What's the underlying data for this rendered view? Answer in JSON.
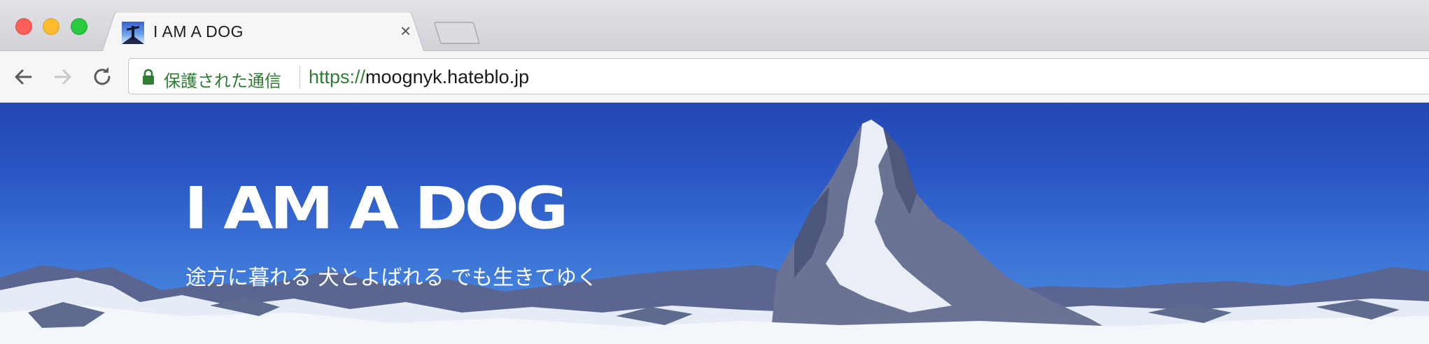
{
  "window": {
    "controls": [
      "close",
      "minimize",
      "maximize"
    ]
  },
  "tab": {
    "title": "I AM A DOG",
    "close_label": "×"
  },
  "toolbar": {
    "back_icon": "arrow-left-icon",
    "forward_icon": "arrow-right-icon",
    "reload_icon": "reload-icon"
  },
  "omnibox": {
    "security_label": "保護された通信",
    "url_scheme": "https://",
    "url_host": "moognyk.hateblo.jp",
    "colors": {
      "secure": "#2e7d32"
    }
  },
  "page": {
    "site_title": "I AM A DOG",
    "site_subtitle": "途方に暮れる 犬とよばれる でも生きてゆく",
    "colors": {
      "sky": "#2347b2",
      "text": "#ffffff"
    }
  }
}
